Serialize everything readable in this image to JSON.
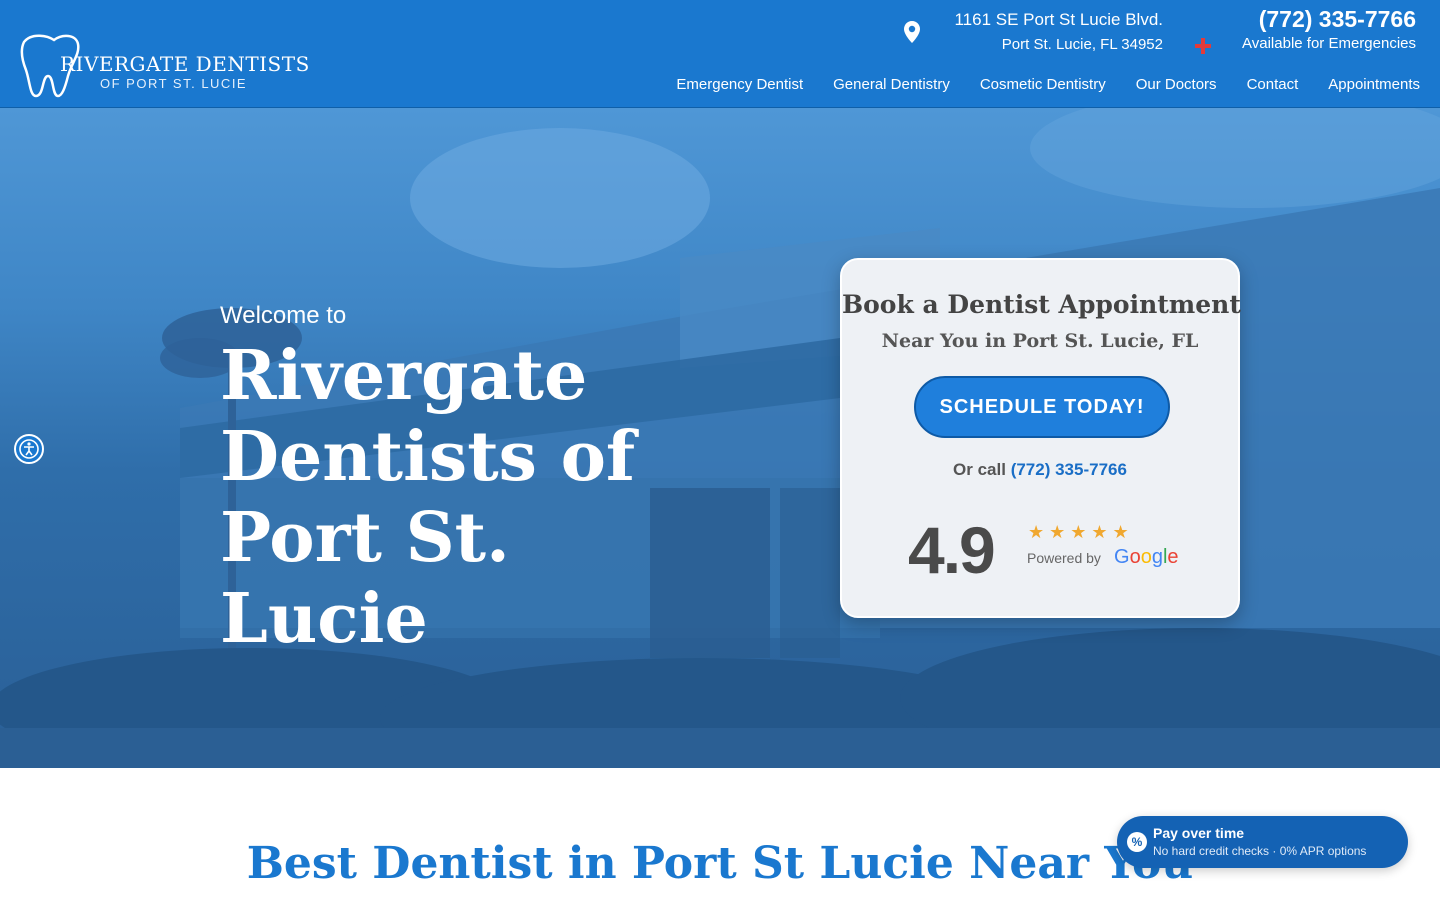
{
  "header": {
    "brand": "RIVERGATE DENTISTS",
    "brand_sub": "OF PORT ST. LUCIE",
    "address_line1": "1161 SE Port St Lucie Blvd.",
    "address_line2": "Port St. Lucie, FL 34952",
    "phone": "(772) 335-7766",
    "emergency": "Available for Emergencies"
  },
  "nav": [
    {
      "label": "Emergency Dentist"
    },
    {
      "label": "General Dentistry"
    },
    {
      "label": "Cosmetic Dentistry"
    },
    {
      "label": "Our Doctors"
    },
    {
      "label": "Contact"
    },
    {
      "label": "Appointments"
    }
  ],
  "hero": {
    "welcome": "Welcome to",
    "title_line1": "Rivergate",
    "title_line2": "Dentists of",
    "title_line3": "Port St. Lucie"
  },
  "card": {
    "title": "Book a Dentist Appointment",
    "subtitle": "Near You in Port St. Lucie, FL",
    "button": "SCHEDULE TODAY!",
    "call_prefix": "Or call",
    "call_number": "(772) 335-7766",
    "rating": "4.9",
    "stars": "★★★★★",
    "powered_by": "Powered by",
    "google": {
      "g": "G",
      "o1": "o",
      "o2": "o",
      "g2": "g",
      "l": "l",
      "e": "e"
    }
  },
  "section": {
    "heading": "Best Dentist in Port St Lucie Near You"
  },
  "pay_widget": {
    "icon": "%",
    "title": "Pay over time",
    "subtitle": "No hard credit checks · 0% APR options"
  },
  "colors": {
    "header_blue": "#1a78cf",
    "button_blue": "#1f7fdc",
    "star_gold": "#f0a830",
    "emergency_red": "#e23b3b"
  },
  "icons": {
    "logo": "tooth-icon",
    "address": "map-pin-icon",
    "emergency": "medical-cross-icon",
    "accessibility": "accessibility-icon"
  }
}
